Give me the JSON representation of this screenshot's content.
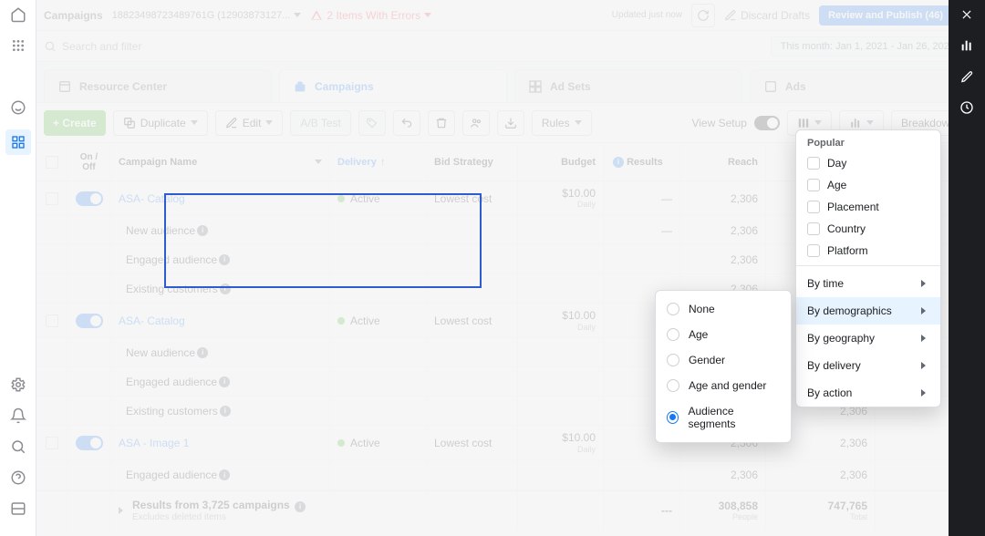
{
  "header": {
    "title": "Campaigns",
    "account_id": "18823498723489761G (12903873127...",
    "errors_label": "2 Items With Errors",
    "updated_label": "Updated just now",
    "discard_label": "Discard Drafts",
    "review_label": "Review and Publish (46)"
  },
  "search": {
    "placeholder": "Search and filter",
    "date_range": "This month: Jan 1, 2021 - Jan 26, 2021"
  },
  "tabs": {
    "resource": "Resource Center",
    "campaigns": "Campaigns",
    "adsets": "Ad Sets",
    "ads": "Ads"
  },
  "toolbar": {
    "create": "+ Create",
    "duplicate": "Duplicate",
    "edit": "Edit",
    "abtest": "A/B Test",
    "rules": "Rules",
    "view_setup": "View Setup",
    "breakdown": "Breakdown"
  },
  "columns": {
    "onoff": "On / Off",
    "name": "Campaign Name",
    "delivery": "Delivery",
    "bid": "Bid Strategy",
    "budget": "Budget",
    "results": "Results",
    "reach": "Reach"
  },
  "rows": [
    {
      "name": "ASA- Catalog",
      "link": true,
      "delivery": "Active",
      "bid": "Lowest cost",
      "budget": "$10.00",
      "budget_sub": "Daily",
      "results": "—",
      "reach": "2,306",
      "toggle": true,
      "sub": false
    },
    {
      "name": "New audience",
      "link": false,
      "delivery": "",
      "bid": "",
      "budget": "",
      "budget_sub": "",
      "results": "—",
      "reach": "2,306",
      "toggle": false,
      "sub": true,
      "info": true
    },
    {
      "name": "Engaged audience",
      "link": false,
      "delivery": "",
      "bid": "",
      "budget": "",
      "budget_sub": "",
      "results": "",
      "reach": "2,306",
      "toggle": false,
      "sub": true,
      "info": true
    },
    {
      "name": "Existing customers",
      "link": false,
      "delivery": "",
      "bid": "",
      "budget": "",
      "budget_sub": "",
      "results": "",
      "reach": "2,306",
      "toggle": false,
      "sub": true,
      "info": true
    },
    {
      "name": "ASA- Catalog",
      "link": true,
      "delivery": "Active",
      "bid": "Lowest cost",
      "budget": "$10.00",
      "budget_sub": "Daily",
      "results": "—",
      "reach": "",
      "toggle": true,
      "sub": false
    },
    {
      "name": "New audience",
      "link": false,
      "delivery": "",
      "bid": "",
      "budget": "",
      "budget_sub": "",
      "results": "",
      "reach": "",
      "toggle": false,
      "sub": true,
      "info": true
    },
    {
      "name": "Engaged audience",
      "link": false,
      "delivery": "",
      "bid": "",
      "budget": "",
      "budget_sub": "",
      "results": "",
      "reach": "",
      "toggle": false,
      "sub": true,
      "info": true
    },
    {
      "name": "Existing customers",
      "link": false,
      "delivery": "",
      "bid": "",
      "budget": "",
      "budget_sub": "",
      "results": "",
      "reach": "6",
      "imp": "2,306",
      "toggle": false,
      "sub": true,
      "info": true
    },
    {
      "name": "ASA - Image 1",
      "link": true,
      "delivery": "Active",
      "bid": "Lowest cost",
      "budget": "$10.00",
      "budget_sub": "Daily",
      "results": "",
      "reach": "2,306",
      "imp": "2,306",
      "toggle": true,
      "sub": false
    },
    {
      "name": "Engaged audience",
      "link": false,
      "delivery": "",
      "bid": "",
      "budget": "",
      "budget_sub": "",
      "results": "",
      "reach": "2,306",
      "imp": "2,306",
      "toggle": false,
      "sub": true,
      "info": true
    }
  ],
  "totals": {
    "label": "Results from 3,725 campaigns",
    "sublabel": "Excludes deleted items",
    "results": "---",
    "reach": "308,858",
    "reach_sub": "People",
    "imp": "747,765",
    "imp_sub": "Total"
  },
  "breakdown_menu": {
    "popular": "Popular",
    "items": [
      "Day",
      "Age",
      "Placement",
      "Country",
      "Platform"
    ],
    "groups": [
      "By time",
      "By demographics",
      "By geography",
      "By delivery",
      "By action"
    ],
    "hover_index": 1
  },
  "demographics_submenu": {
    "items": [
      "None",
      "Age",
      "Gender",
      "Age and gender",
      "Audience segments"
    ],
    "selected_index": 4
  }
}
